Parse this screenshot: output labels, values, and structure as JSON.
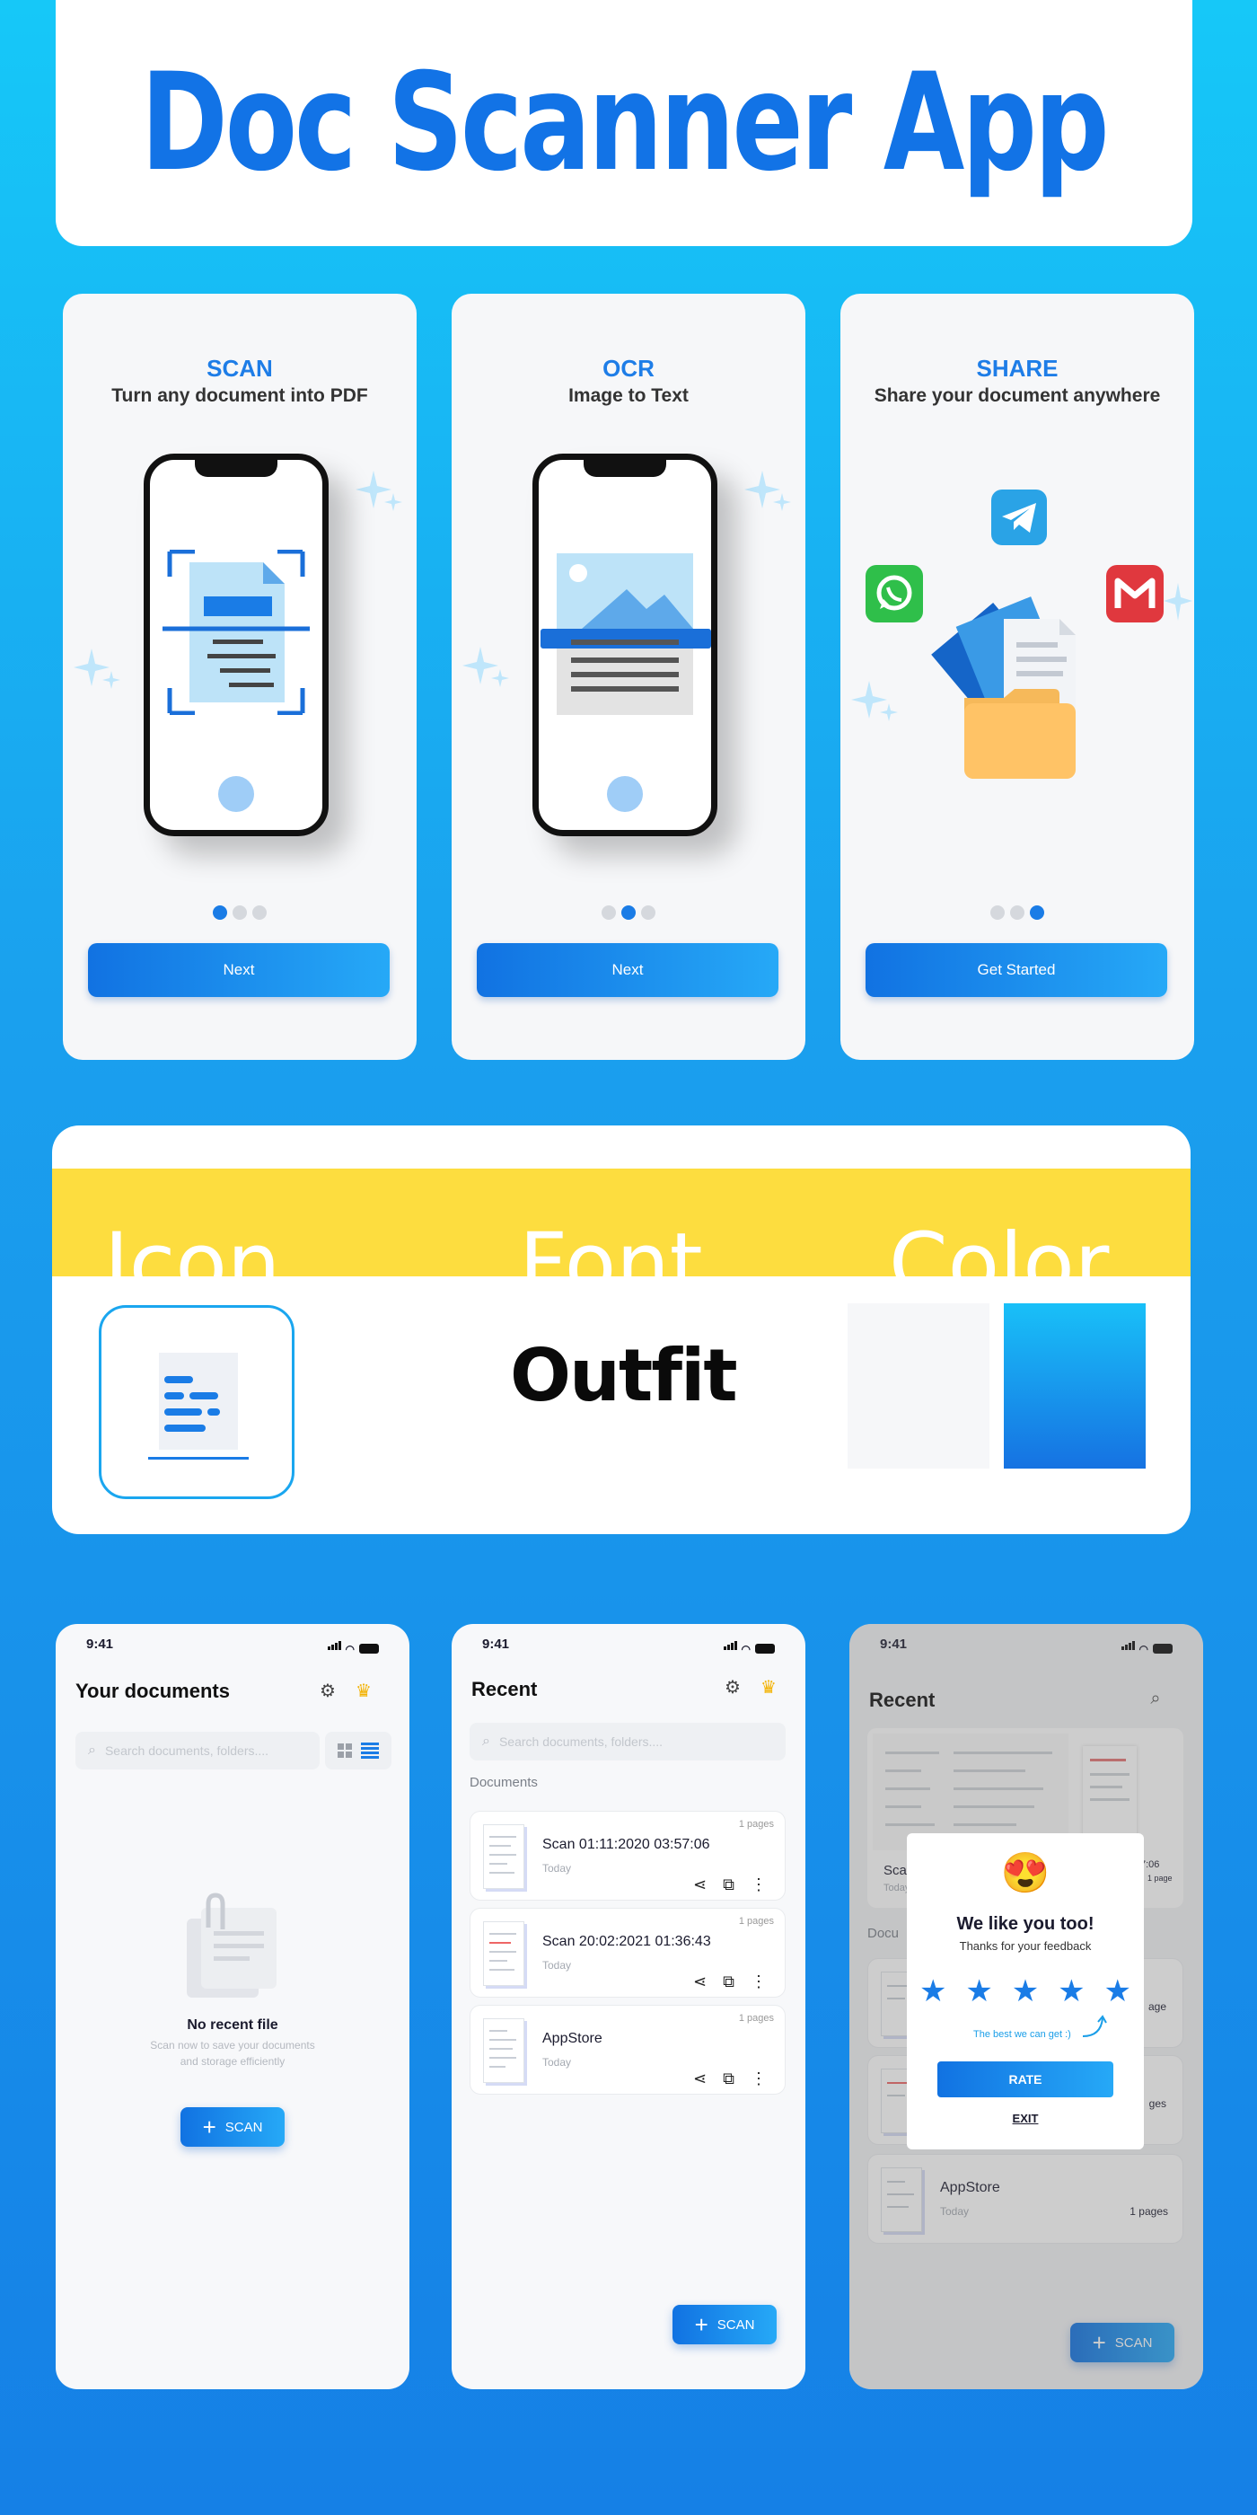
{
  "header": {
    "title": "Doc Scanner App"
  },
  "onboarding": [
    {
      "heading": "SCAN",
      "subtitle": "Turn any document into PDF",
      "button": "Next",
      "active_dot": 0
    },
    {
      "heading": "OCR",
      "subtitle": "Image to Text",
      "button": "Next",
      "active_dot": 1
    },
    {
      "heading": "SHARE",
      "subtitle": "Share your document anywhere",
      "button": "Get Started",
      "active_dot": 2
    }
  ],
  "features": {
    "icon_label": "Icon",
    "font_label": "Font",
    "color_label": "Color",
    "font_name": "Outfit",
    "colors": [
      "#f6f7f9",
      "#1aa8f2"
    ]
  },
  "screen1": {
    "time": "9:41",
    "title": "Your documents",
    "search_placeholder": "Search documents, folders....",
    "empty_title": "No recent file",
    "empty_line1": "Scan now to save your documents",
    "empty_line2": "and storage efficiently",
    "scan_label": "SCAN"
  },
  "screen2": {
    "time": "9:41",
    "title": "Recent",
    "search_placeholder": "Search documents, folders....",
    "section": "Documents",
    "docs": [
      {
        "name": "Scan 01:11:2020 03:57:06",
        "date": "Today",
        "pages": "1 pages"
      },
      {
        "name": "Scan 20:02:2021 01:36:43",
        "date": "Today",
        "pages": "1 pages"
      },
      {
        "name": "AppStore",
        "date": "Today",
        "pages": "1 pages"
      }
    ],
    "scan_label": "SCAN"
  },
  "screen3": {
    "time": "9:41",
    "title": "Recent",
    "bg_doc_name": "AppStore",
    "bg_doc_date": "Today",
    "bg_doc_pages": "1 pages",
    "partial_scan": "Scan",
    "partial_today": "Today",
    "partial_section": "Docu",
    "partial_time": "7:06",
    "partial_page": "1 page",
    "partial_age1": "age",
    "partial_age2": "ges",
    "dialog": {
      "emoji": "😍",
      "title": "We like you too!",
      "subtitle": "Thanks for your feedback",
      "stars": 5,
      "hint": "The best we can get :)",
      "rate": "RATE",
      "exit": "EXIT"
    },
    "scan_label": "SCAN"
  },
  "colors": {
    "primary": "#1a7ce6",
    "accent": "#26a9f7",
    "yellow": "#fddd3f"
  }
}
